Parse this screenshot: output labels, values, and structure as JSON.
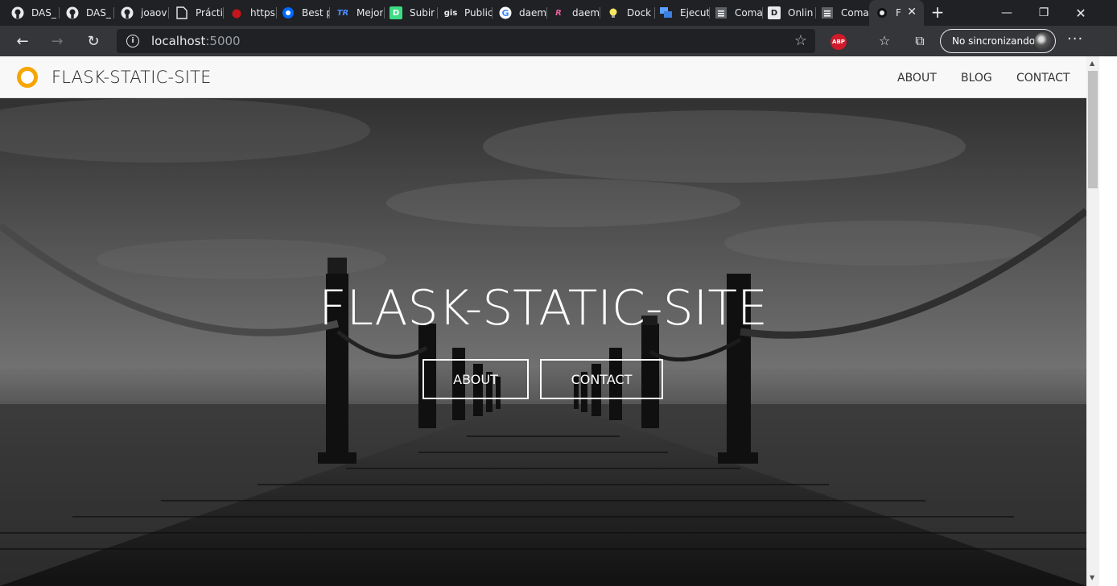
{
  "browser": {
    "tabs": [
      {
        "label": "DAS_",
        "icon": "github-icon"
      },
      {
        "label": "DAS_",
        "icon": "github-icon"
      },
      {
        "label": "joaov",
        "icon": "github-icon"
      },
      {
        "label": "Prácti",
        "icon": "document-icon"
      },
      {
        "label": "https:",
        "icon": "red-dot-icon"
      },
      {
        "label": "Best p",
        "icon": "digitalocean-icon"
      },
      {
        "label": "Mejor",
        "icon": "site-icon"
      },
      {
        "label": "Subir",
        "icon": "d-icon"
      },
      {
        "label": "Public",
        "icon": "gis-icon"
      },
      {
        "label": "daem",
        "icon": "google-icon"
      },
      {
        "label": "daem",
        "icon": "r-icon"
      },
      {
        "label": "Dock",
        "icon": "bulb-icon"
      },
      {
        "label": "Ejecut",
        "icon": "chat-icon"
      },
      {
        "label": "Coma",
        "icon": "list-icon"
      },
      {
        "label": "Onlin",
        "icon": "d-dark-icon"
      },
      {
        "label": "Coma",
        "icon": "list-icon"
      },
      {
        "label": "F",
        "icon": "circle-icon",
        "active": true
      }
    ],
    "url_host": "localhost",
    "url_port": ":5000",
    "abp_label": "ABP",
    "sync_label": "No sincronizando"
  },
  "site": {
    "brand": "FLASK-STATIC-SITE",
    "nav": [
      "ABOUT",
      "BLOG",
      "CONTACT"
    ],
    "hero": {
      "title": "FLASK-STATIC-SITE",
      "buttons": [
        "ABOUT",
        "CONTACT"
      ]
    },
    "logo_color": "#f6a600"
  }
}
